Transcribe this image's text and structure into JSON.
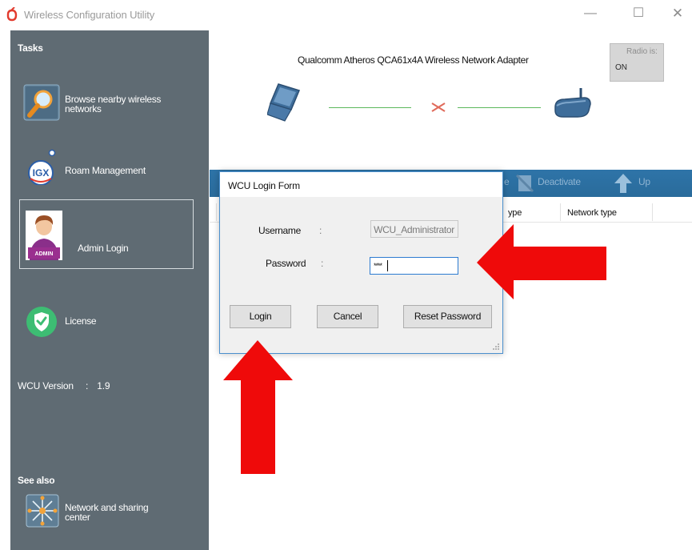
{
  "window": {
    "title": "Wireless Configuration Utility",
    "minimize_glyph": "—",
    "maximize_glyph": "☐",
    "close_glyph": "✕"
  },
  "sidebar": {
    "tasks_heading": "Tasks",
    "items": [
      {
        "label_line1": "Browse nearby wireless",
        "label_line2": "networks",
        "icon": "browse-magnifier-icon"
      },
      {
        "label": "Roam Management",
        "icon": "igx-roam-logo-icon"
      },
      {
        "label": "Admin Login",
        "icon": "admin-avatar-icon",
        "badge": "ADMIN",
        "selected": true
      },
      {
        "label": "License",
        "icon": "shield-check-icon"
      }
    ],
    "version_label": "WCU Version",
    "version_sep": ":",
    "version_value": "1.9",
    "see_also_heading": "See also",
    "network_center_line1": "Network and sharing",
    "network_center_line2": "center"
  },
  "header": {
    "adapter_name": "Qualcomm Atheros QCA61x4A Wireless Network Adapter",
    "radio_label": "Radio is:",
    "radio_value": "ON"
  },
  "toolbar": {
    "partial_label": "e",
    "deactivate_label": "Deactivate",
    "up_label": "Up"
  },
  "table": {
    "columns": [
      "",
      "ype",
      "Network type"
    ]
  },
  "login_form": {
    "title": "WCU Login Form",
    "username_label": "Username",
    "username_value": "WCU_Administrator",
    "password_label": "Password",
    "password_mask": "****",
    "colon": ":",
    "login_button": "Login",
    "cancel_button": "Cancel",
    "reset_button": "Reset Password"
  },
  "colors": {
    "sidebar_bg": "#5f6b73",
    "toolbar_bg": "#2e74a8",
    "modal_border": "#4a8fcd",
    "annotation_arrow": "#ef0a0a",
    "link_line": "#5cb85c"
  }
}
